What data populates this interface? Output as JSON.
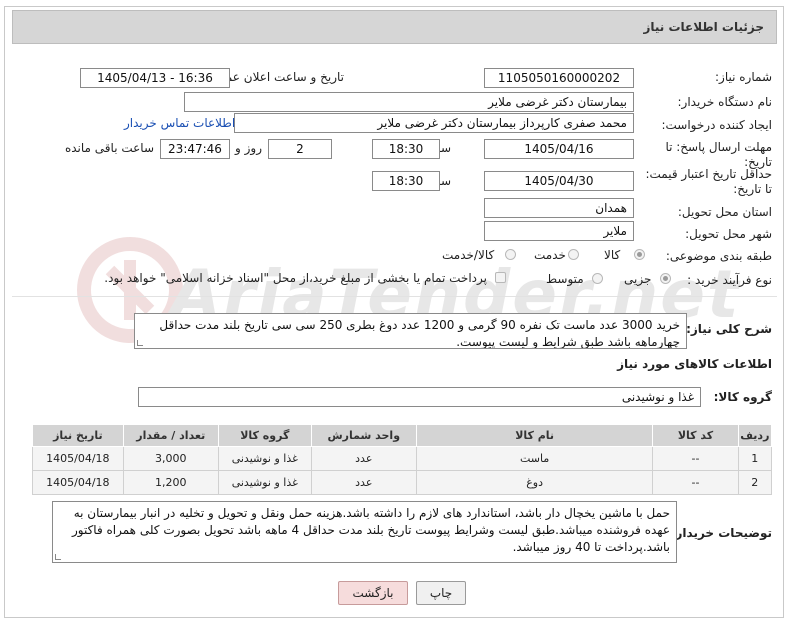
{
  "header": {
    "title": "جزئیات اطلاعات نیاز"
  },
  "watermark": {
    "text": "AriaTender.net"
  },
  "form": {
    "need_number_label": "شماره نیاز:",
    "need_number": "1105050160000202",
    "announce_label": "تاریخ و ساعت اعلان عمومی:",
    "announce_value": "1405/04/13 - 16:36",
    "buyer_org_label": "نام دستگاه خریدار:",
    "buyer_org": "بیمارستان دکتر غرضی ملایر",
    "creator_label": "ایجاد کننده درخواست:",
    "creator": "محمد صفری کارپرداز بیمارستان دکتر غرضی ملایر",
    "contact_link": "اطلاعات تماس خریدار",
    "deadline_label": "مهلت ارسال پاسخ: تا تاریخ:",
    "deadline_date": "1405/04/16",
    "time_label": "ساعت",
    "deadline_time": "18:30",
    "days_value": "2",
    "days_label": "روز و",
    "remaining_value": "23:47:46",
    "remaining_label": "ساعت باقی مانده",
    "validity_label": "حداقل تاریخ اعتبار قیمت: تا تاریخ:",
    "validity_date": "1405/04/30",
    "validity_time": "18:30",
    "province_label": "استان محل تحویل:",
    "province": "همدان",
    "city_label": "شهر محل تحویل:",
    "city": "ملایر",
    "category_label": "طبقه بندی موضوعی:",
    "category_options": [
      "کالا",
      "خدمت",
      "کالا/خدمت"
    ],
    "category_selected": "کالا",
    "process_label": "نوع فرآیند خرید :",
    "process_options": [
      "جزیی",
      "متوسط"
    ],
    "process_selected": "جزیی",
    "payment_note": "پرداخت تمام یا بخشی از مبلغ خرید،از محل \"اسناد خزانه اسلامی\" خواهد بود."
  },
  "description": {
    "label": "شرح کلی نیاز:",
    "text": "خرید 3000 عدد ماست تک نفره 90 گرمی و 1200 عدد دوغ بطری  250 سی سی تاریخ بلند مدت حداقل چهارماهه باشد طبق شرایط و لیست پیوست."
  },
  "goods": {
    "section_title": "اطلاعات کالاهای مورد نیاز",
    "group_label": "گروه کالا:",
    "group_value": "غذا و نوشیدنی",
    "columns": [
      "ردیف",
      "کد کالا",
      "نام کالا",
      "واحد شمارش",
      "گروه کالا",
      "تعداد / مقدار",
      "تاریخ نیاز"
    ],
    "rows": [
      [
        "1",
        "--",
        "ماست",
        "عدد",
        "غذا و نوشیدنی",
        "3,000",
        "1405/04/18"
      ],
      [
        "2",
        "--",
        "دوغ",
        "عدد",
        "غذا و نوشیدنی",
        "1,200",
        "1405/04/18"
      ]
    ]
  },
  "buyer_notes": {
    "label": "توضیحات خریدار:",
    "text": "حمل با ماشین یخچال دار باشد، استاندارد های لازم را داشته باشد.هزینه حمل ونقل و تحویل و تخلیه در انبار بیمارستان به عهده فروشنده میباشد.طبق لیست وشرایط پیوست تاریخ بلند مدت حداقل  4 ماهه باشد تحویل بصورت کلی همراه فاکتور باشد.پرداخت تا 40 روز میباشد."
  },
  "buttons": {
    "print": "چاپ",
    "back": "بازگشت"
  }
}
